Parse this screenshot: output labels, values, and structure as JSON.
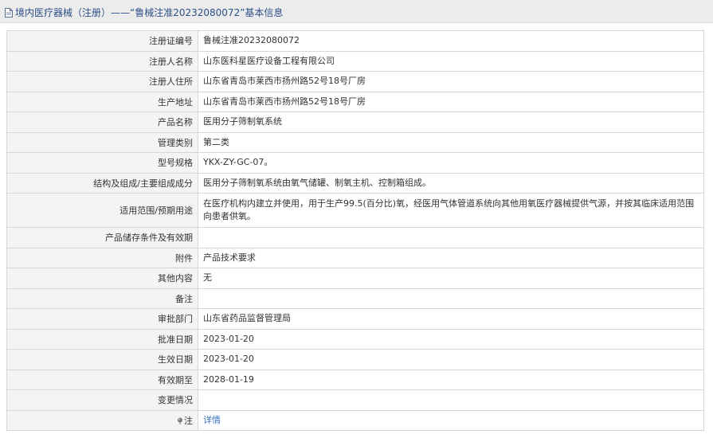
{
  "header": {
    "title": "境内医疗器械（注册）——“鲁械注准20232080072”基本信息",
    "icon": "document-icon"
  },
  "rows": [
    {
      "label": "注册证编号",
      "value": "鲁械注准20232080072"
    },
    {
      "label": "注册人名称",
      "value": "山东医科星医疗设备工程有限公司"
    },
    {
      "label": "注册人住所",
      "value": "山东省青岛市莱西市扬州路52号18号厂房"
    },
    {
      "label": "生产地址",
      "value": "山东省青岛市莱西市扬州路52号18号厂房"
    },
    {
      "label": "产品名称",
      "value": "医用分子筛制氧系统"
    },
    {
      "label": "管理类别",
      "value": "第二类"
    },
    {
      "label": "型号规格",
      "value": "YKX-ZY-GC-07。"
    },
    {
      "label": "结构及组成/主要组成成分",
      "value": "医用分子筛制氧系统由氧气储罐、制氧主机、控制箱组成。"
    },
    {
      "label": "适用范围/预期用途",
      "value": "在医疗机构内建立并使用，用于生产99.5(百分比)氧，经医用气体管道系统向其他用氧医疗器械提供气源，并按其临床适用范围向患者供氧。"
    },
    {
      "label": "产品储存条件及有效期",
      "value": ""
    },
    {
      "label": "附件",
      "value": "产品技术要求"
    },
    {
      "label": "其他内容",
      "value": "无"
    },
    {
      "label": "备注",
      "value": ""
    },
    {
      "label": "审批部门",
      "value": "山东省药品监督管理局"
    },
    {
      "label": "批准日期",
      "value": "2023-01-20"
    },
    {
      "label": "生效日期",
      "value": "2023-01-20"
    },
    {
      "label": "有效期至",
      "value": "2028-01-19"
    },
    {
      "label": "变更情况",
      "value": ""
    }
  ],
  "note": {
    "label": "注",
    "icon": "pin-icon",
    "link_text": "详情"
  },
  "colors": {
    "title_text": "#2b4f86",
    "link": "#3a6fc4",
    "label_bg": "#f4f4f4",
    "border": "#d7d7d7"
  }
}
